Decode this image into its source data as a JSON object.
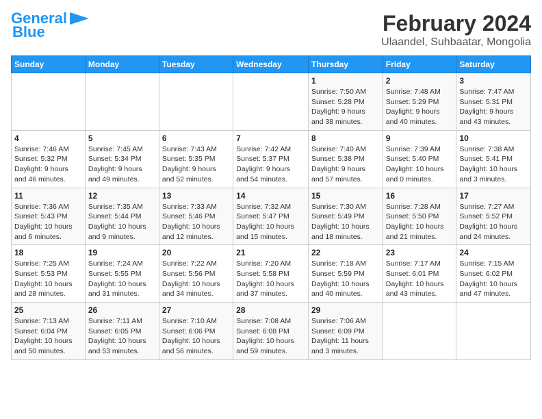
{
  "logo": {
    "line1": "General",
    "line2": "Blue"
  },
  "title": "February 2024",
  "subtitle": "Ulaandel, Suhbaatar, Mongolia",
  "weekdays": [
    "Sunday",
    "Monday",
    "Tuesday",
    "Wednesday",
    "Thursday",
    "Friday",
    "Saturday"
  ],
  "weeks": [
    [
      {
        "day": "",
        "info": ""
      },
      {
        "day": "",
        "info": ""
      },
      {
        "day": "",
        "info": ""
      },
      {
        "day": "",
        "info": ""
      },
      {
        "day": "1",
        "info": "Sunrise: 7:50 AM\nSunset: 5:28 PM\nDaylight: 9 hours\nand 38 minutes."
      },
      {
        "day": "2",
        "info": "Sunrise: 7:48 AM\nSunset: 5:29 PM\nDaylight: 9 hours\nand 40 minutes."
      },
      {
        "day": "3",
        "info": "Sunrise: 7:47 AM\nSunset: 5:31 PM\nDaylight: 9 hours\nand 43 minutes."
      }
    ],
    [
      {
        "day": "4",
        "info": "Sunrise: 7:46 AM\nSunset: 5:32 PM\nDaylight: 9 hours\nand 46 minutes."
      },
      {
        "day": "5",
        "info": "Sunrise: 7:45 AM\nSunset: 5:34 PM\nDaylight: 9 hours\nand 49 minutes."
      },
      {
        "day": "6",
        "info": "Sunrise: 7:43 AM\nSunset: 5:35 PM\nDaylight: 9 hours\nand 52 minutes."
      },
      {
        "day": "7",
        "info": "Sunrise: 7:42 AM\nSunset: 5:37 PM\nDaylight: 9 hours\nand 54 minutes."
      },
      {
        "day": "8",
        "info": "Sunrise: 7:40 AM\nSunset: 5:38 PM\nDaylight: 9 hours\nand 57 minutes."
      },
      {
        "day": "9",
        "info": "Sunrise: 7:39 AM\nSunset: 5:40 PM\nDaylight: 10 hours\nand 0 minutes."
      },
      {
        "day": "10",
        "info": "Sunrise: 7:38 AM\nSunset: 5:41 PM\nDaylight: 10 hours\nand 3 minutes."
      }
    ],
    [
      {
        "day": "11",
        "info": "Sunrise: 7:36 AM\nSunset: 5:43 PM\nDaylight: 10 hours\nand 6 minutes."
      },
      {
        "day": "12",
        "info": "Sunrise: 7:35 AM\nSunset: 5:44 PM\nDaylight: 10 hours\nand 9 minutes."
      },
      {
        "day": "13",
        "info": "Sunrise: 7:33 AM\nSunset: 5:46 PM\nDaylight: 10 hours\nand 12 minutes."
      },
      {
        "day": "14",
        "info": "Sunrise: 7:32 AM\nSunset: 5:47 PM\nDaylight: 10 hours\nand 15 minutes."
      },
      {
        "day": "15",
        "info": "Sunrise: 7:30 AM\nSunset: 5:49 PM\nDaylight: 10 hours\nand 18 minutes."
      },
      {
        "day": "16",
        "info": "Sunrise: 7:28 AM\nSunset: 5:50 PM\nDaylight: 10 hours\nand 21 minutes."
      },
      {
        "day": "17",
        "info": "Sunrise: 7:27 AM\nSunset: 5:52 PM\nDaylight: 10 hours\nand 24 minutes."
      }
    ],
    [
      {
        "day": "18",
        "info": "Sunrise: 7:25 AM\nSunset: 5:53 PM\nDaylight: 10 hours\nand 28 minutes."
      },
      {
        "day": "19",
        "info": "Sunrise: 7:24 AM\nSunset: 5:55 PM\nDaylight: 10 hours\nand 31 minutes."
      },
      {
        "day": "20",
        "info": "Sunrise: 7:22 AM\nSunset: 5:56 PM\nDaylight: 10 hours\nand 34 minutes."
      },
      {
        "day": "21",
        "info": "Sunrise: 7:20 AM\nSunset: 5:58 PM\nDaylight: 10 hours\nand 37 minutes."
      },
      {
        "day": "22",
        "info": "Sunrise: 7:18 AM\nSunset: 5:59 PM\nDaylight: 10 hours\nand 40 minutes."
      },
      {
        "day": "23",
        "info": "Sunrise: 7:17 AM\nSunset: 6:01 PM\nDaylight: 10 hours\nand 43 minutes."
      },
      {
        "day": "24",
        "info": "Sunrise: 7:15 AM\nSunset: 6:02 PM\nDaylight: 10 hours\nand 47 minutes."
      }
    ],
    [
      {
        "day": "25",
        "info": "Sunrise: 7:13 AM\nSunset: 6:04 PM\nDaylight: 10 hours\nand 50 minutes."
      },
      {
        "day": "26",
        "info": "Sunrise: 7:11 AM\nSunset: 6:05 PM\nDaylight: 10 hours\nand 53 minutes."
      },
      {
        "day": "27",
        "info": "Sunrise: 7:10 AM\nSunset: 6:06 PM\nDaylight: 10 hours\nand 56 minutes."
      },
      {
        "day": "28",
        "info": "Sunrise: 7:08 AM\nSunset: 6:08 PM\nDaylight: 10 hours\nand 59 minutes."
      },
      {
        "day": "29",
        "info": "Sunrise: 7:06 AM\nSunset: 6:09 PM\nDaylight: 11 hours\nand 3 minutes."
      },
      {
        "day": "",
        "info": ""
      },
      {
        "day": "",
        "info": ""
      }
    ]
  ]
}
